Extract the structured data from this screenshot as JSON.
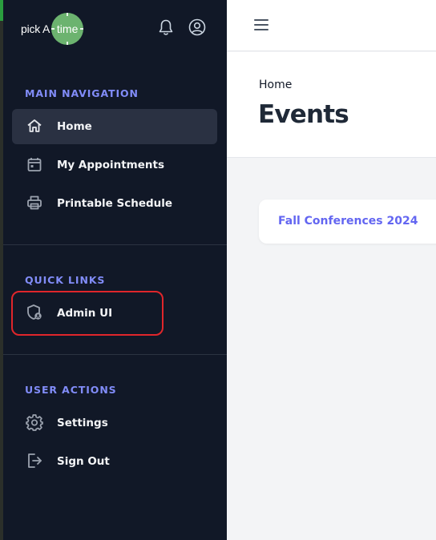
{
  "brand": {
    "logo_text": "pick A",
    "logo_circle_text": "time"
  },
  "header_icons": {
    "notifications": "bell-icon",
    "account": "user-circle-icon"
  },
  "sidebar": {
    "sections": [
      {
        "title": "MAIN NAVIGATION",
        "items": [
          {
            "label": "Home",
            "icon": "home-icon",
            "active": true
          },
          {
            "label": "My Appointments",
            "icon": "calendar-icon",
            "active": false
          },
          {
            "label": "Printable Schedule",
            "icon": "printer-icon",
            "active": false
          }
        ]
      },
      {
        "title": "QUICK LINKS",
        "items": [
          {
            "label": "Admin UI",
            "icon": "shield-user-icon",
            "active": false
          }
        ]
      },
      {
        "title": "USER ACTIONS",
        "items": [
          {
            "label": "Settings",
            "icon": "gear-icon",
            "active": false
          },
          {
            "label": "Sign Out",
            "icon": "sign-out-icon",
            "active": false
          }
        ]
      }
    ]
  },
  "main": {
    "breadcrumb": "Home",
    "title": "Events",
    "events": [
      {
        "name": "Fall Conferences 2024"
      }
    ]
  },
  "colors": {
    "sidebar_bg": "#111827",
    "section_title": "#818cf8",
    "accent_link": "#6366f1",
    "highlight": "#e0262b"
  }
}
